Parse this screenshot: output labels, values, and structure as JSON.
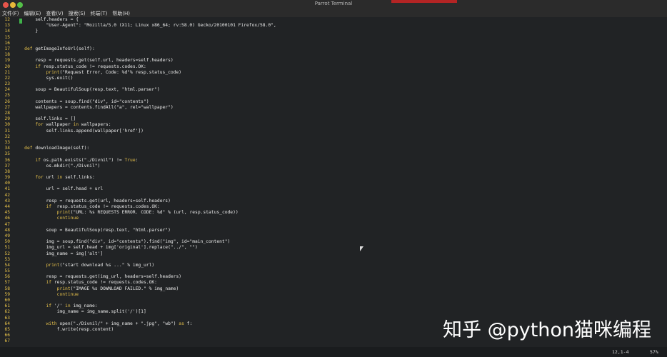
{
  "window": {
    "title": "Parrot Terminal"
  },
  "menu": {
    "items": [
      "文件(F)",
      "编辑(E)",
      "查看(V)",
      "搜索(S)",
      "终端(T)",
      "帮助(H)"
    ]
  },
  "editor": {
    "line_numbers": [
      "12",
      "13",
      "14",
      "15",
      "16",
      "17",
      "18",
      "19",
      "20",
      "21",
      "22",
      "23",
      "24",
      "25",
      "26",
      "27",
      "28",
      "29",
      "30",
      "31",
      "32",
      "33",
      "34",
      "35",
      "36",
      "37",
      "38",
      "39",
      "40",
      "41",
      "42",
      "43",
      "44",
      "45",
      "46",
      "47",
      "48",
      "49",
      "50",
      "51",
      "52",
      "53",
      "54",
      "55",
      "56",
      "57",
      "58",
      "59",
      "60",
      "61",
      "62",
      "63",
      "64",
      "65",
      "66",
      "67"
    ],
    "code_lines": [
      "        self.headers = {",
      "            \"User-Agent\": \"Mozilla/5.0 (X11; Linux x86_64; rv:58.0) Gecko/20100101 Firefox/58.0\",",
      "        }",
      "",
      "",
      "    def getImageInfoUrl(self):",
      "",
      "        resp = requests.get(self.url, headers=self.headers)",
      "        if resp.status_code != requests.codes.OK:",
      "            print(\"Request Error, Code: %d\"% resp.status_code)",
      "            sys.exit()",
      "",
      "        soup = BeautifulSoup(resp.text, \"html.parser\")",
      "",
      "        contents = soup.find(\"div\", id=\"contents\")",
      "        wallpapers = contents.findAll(\"a\", rel=\"wallpaper\")",
      "",
      "        self.links = []",
      "        for wallpaper in wallpapers:",
      "            self.links.append(wallpaper['href'])",
      "",
      "",
      "    def downloadImage(self):",
      "",
      "        if os.path.exists(\"./Divnil\") != True:",
      "            os.mkdir(\"./Divnil\")",
      "",
      "        for url in self.links:",
      "",
      "            url = self.head + url",
      "",
      "            resp = requests.get(url, headers=self.headers)",
      "            if  resp.status_code != requests.codes.OK:",
      "                print(\"URL: %s REQUESTS ERROR. CODE: %d\" % (url, resp.status_code))",
      "                continue",
      "",
      "            soup = BeautifulSoup(resp.text, \"html.parser\")",
      "",
      "            img = soup.find(\"div\", id=\"contents\").find(\"img\", id=\"main_content\")",
      "            img_url = self.head + img['original'].replace(\"../\", \"\")",
      "            img_name = img['alt']",
      "",
      "            print(\"start download %s ...\" % img_url)",
      "",
      "            resp = requests.get(img_url, headers=self.headers)",
      "            if resp.status_code != requests.codes.OK:",
      "                print(\"IMAGE %s DOWNLOAD FAILED.\" % img_name)",
      "                continue",
      "",
      "            if '/' in img_name:",
      "                img_name = img_name.split('/')[1]",
      "",
      "            with open(\"./Divnil/\" + img_name + \".jpg\", \"wb\") as f:",
      "                f.write(resp.content)",
      "",
      ""
    ]
  },
  "status": {
    "position": "12,1-4",
    "percent": "57%"
  },
  "watermark": {
    "text": "知乎 @python猫咪编程"
  },
  "colors": {
    "background": "#222426",
    "line_number": "#e8c349",
    "keyword": "#e6c14b",
    "text": "#e9e9e9",
    "cursor": "#3fb24a"
  }
}
